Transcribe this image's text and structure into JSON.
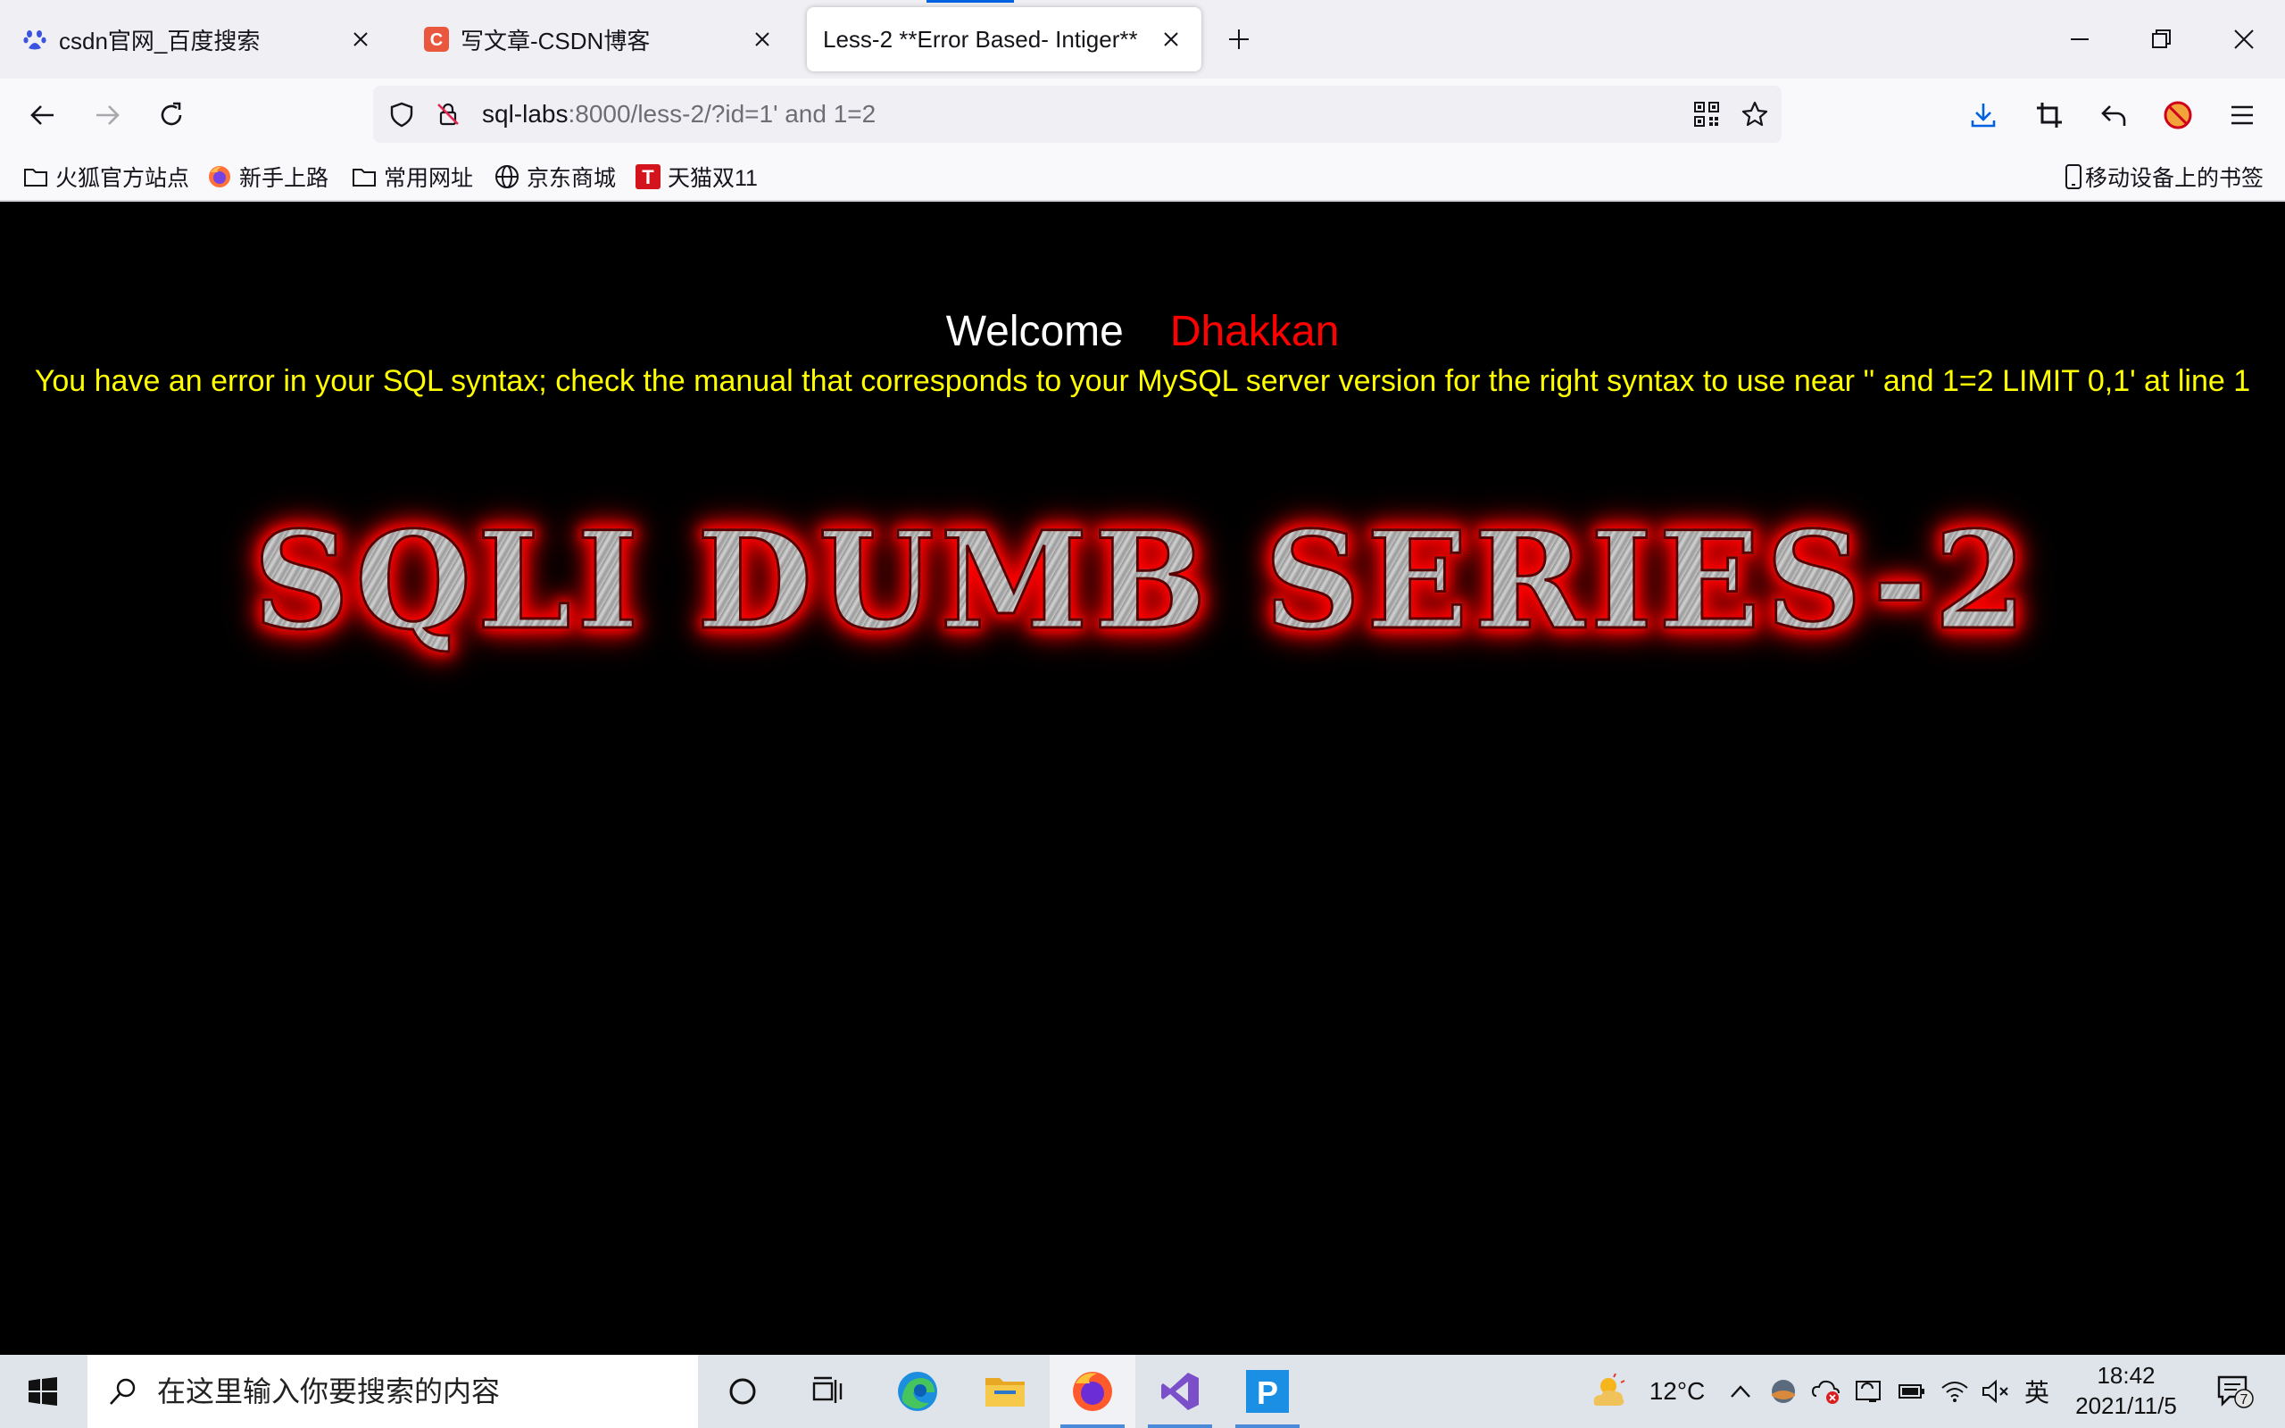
{
  "browser": {
    "tabs": [
      {
        "title": "csdn官网_百度搜索",
        "favicon": "baidu-paw-icon"
      },
      {
        "title": "写文章-CSDN博客",
        "favicon": "csdn-c-icon"
      },
      {
        "title": "Less-2 **Error Based- Intiger**",
        "favicon": "none"
      }
    ],
    "active_tab_index": 2,
    "url": {
      "host": "sql-labs",
      "rest": ":8000/less-2/?id=1' and 1=2"
    },
    "bookmarks": [
      {
        "label": "火狐官方站点",
        "icon": "folder-icon"
      },
      {
        "label": "新手上路",
        "icon": "firefox-icon"
      },
      {
        "label": "常用网址",
        "icon": "folder-icon"
      },
      {
        "label": "京东商城",
        "icon": "globe-icon"
      },
      {
        "label": "天猫双11",
        "icon": "tmall-icon"
      }
    ],
    "mobile_bookmarks": "移动设备上的书签"
  },
  "page": {
    "welcome": "Welcome",
    "name": "Dhakkan",
    "error": "You have an error in your SQL syntax; check the manual that corresponds to your MySQL server version for the right syntax to use near '' and 1=2 LIMIT 0,1' at line 1",
    "banner": "SQLI DUMB SERIES-2",
    "colors": {
      "background": "#000000",
      "welcome": "#ffffff",
      "name": "#ff0000",
      "error": "#ffff00",
      "banner_glow": "#ff0000"
    }
  },
  "taskbar": {
    "search_placeholder": "在这里输入你要搜索的内容",
    "apps": [
      "cortana-icon",
      "task-view-icon",
      "edge-icon",
      "file-explorer-icon",
      "firefox-icon",
      "visual-studio-icon",
      "pycharm-p-icon"
    ],
    "weather": "12°C",
    "ime": "英",
    "time": "18:42",
    "date": "2021/11/5",
    "notification_count": "7"
  }
}
